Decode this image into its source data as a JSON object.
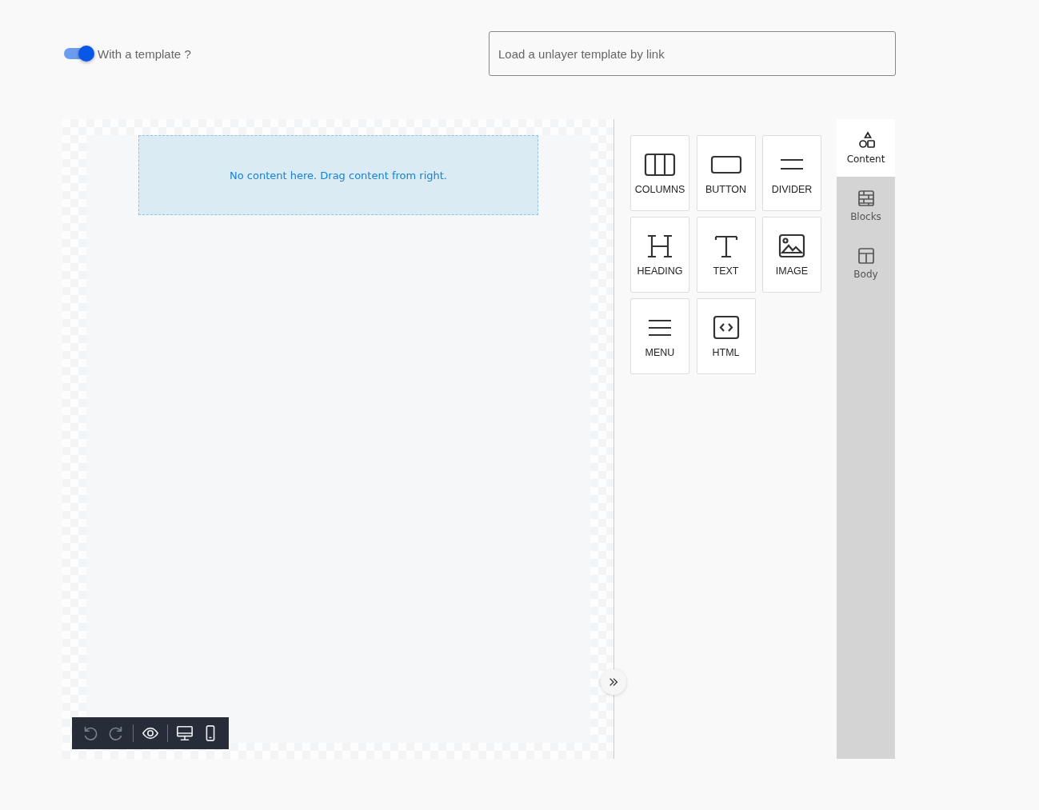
{
  "template_toggle": {
    "label": "With a template ?",
    "on": true
  },
  "template_link_field": {
    "placeholder": "Load a unlayer template by link"
  },
  "canvas": {
    "empty_message": "No content here. Drag content from right."
  },
  "content_tools": [
    {
      "kind": "columns",
      "label": "COLUMNS"
    },
    {
      "kind": "button",
      "label": "BUTTON"
    },
    {
      "kind": "divider",
      "label": "DIVIDER"
    },
    {
      "kind": "heading",
      "label": "HEADING"
    },
    {
      "kind": "text",
      "label": "TEXT"
    },
    {
      "kind": "image",
      "label": "IMAGE"
    },
    {
      "kind": "menu",
      "label": "MENU"
    },
    {
      "kind": "html",
      "label": "HTML"
    }
  ],
  "side_tabs": [
    {
      "kind": "content",
      "label": "Content",
      "selected": true
    },
    {
      "kind": "blocks",
      "label": "Blocks",
      "selected": false
    },
    {
      "kind": "body",
      "label": "Body",
      "selected": false
    }
  ],
  "toolbar": [
    {
      "kind": "undo",
      "disabled": true
    },
    {
      "kind": "redo",
      "disabled": true
    },
    {
      "kind": "preview",
      "disabled": false
    },
    {
      "kind": "desktop",
      "disabled": false
    },
    {
      "kind": "mobile",
      "disabled": false
    }
  ]
}
